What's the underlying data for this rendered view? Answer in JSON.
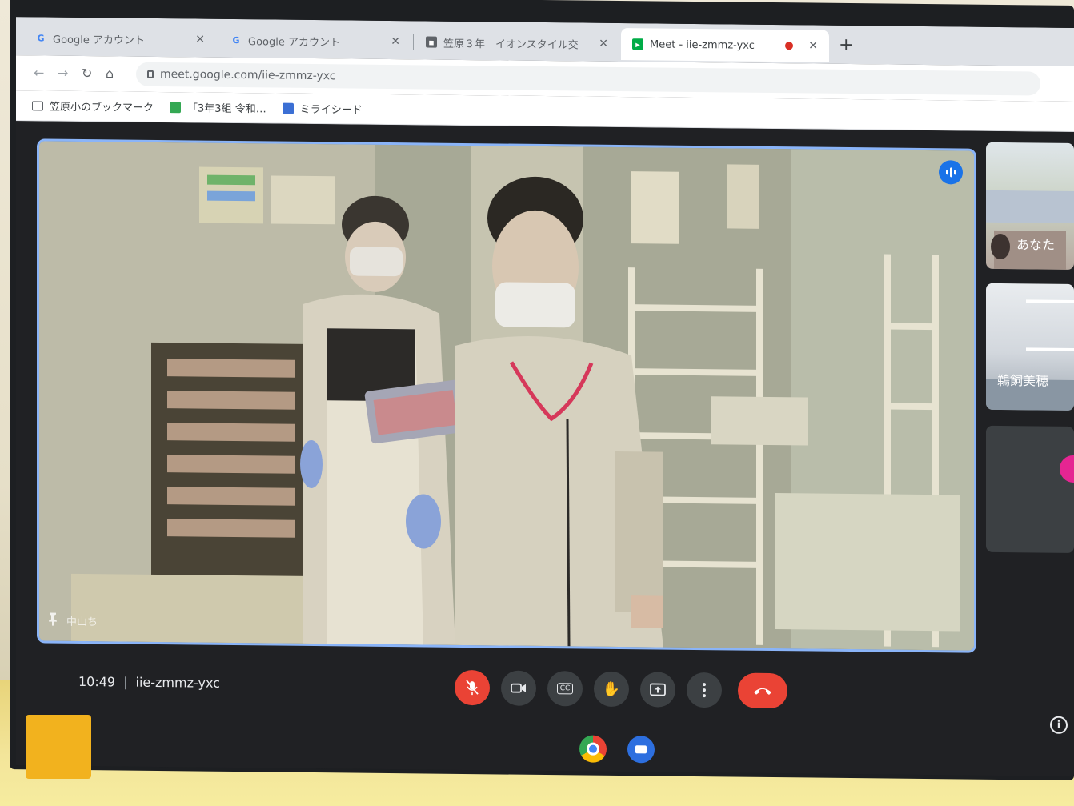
{
  "tabs": [
    {
      "label": "Google アカウント",
      "favicon": "google-g-icon"
    },
    {
      "label": "Google アカウント",
      "favicon": "google-g-icon"
    },
    {
      "label": "笠原３年　イオンスタイル交",
      "favicon": "classroom-icon"
    },
    {
      "label": "Meet - iie-zmmz-yxc",
      "favicon": "meet-icon",
      "active": true,
      "recording": true
    }
  ],
  "address_bar": {
    "url": "meet.google.com/iie-zmmz-yxc"
  },
  "bookmarks": [
    {
      "label": "笠原小のブックマーク",
      "icon": "folder-icon"
    },
    {
      "label": "「3年3組 令和…",
      "icon": "classroom-icon"
    },
    {
      "label": "ミライシード",
      "icon": "app-icon"
    }
  ],
  "meet": {
    "main_tile_name": "中山ち",
    "participants": [
      {
        "name": "あなた"
      },
      {
        "name": "鵜飼美穂"
      },
      {
        "name": ""
      }
    ],
    "time": "10:49",
    "meeting_code": "iie-zmmz-yxc"
  },
  "colors": {
    "tile_border": "#8ab4f8",
    "end_call": "#ea4335",
    "control_bg": "#3c4043"
  }
}
